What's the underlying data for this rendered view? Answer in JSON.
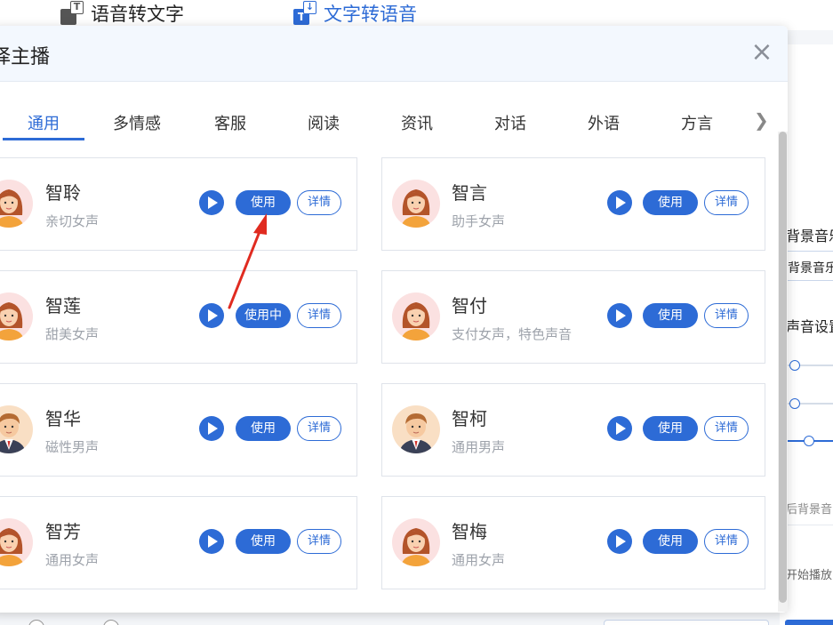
{
  "colors": {
    "accent": "#2d6bd6",
    "annotation_arrow": "#e02b20"
  },
  "top_tabs": [
    {
      "label": "语音转文字",
      "icon": "speech-to-text-icon",
      "active": false
    },
    {
      "label": "文字转语音",
      "icon": "text-to-speech-icon",
      "active": true
    }
  ],
  "modal": {
    "title": "择主播",
    "tabs": [
      "通用",
      "多情感",
      "客服",
      "阅读",
      "资讯",
      "对话",
      "外语",
      "方言"
    ],
    "active_tab": "通用"
  },
  "voices": [
    {
      "name": "智聆",
      "desc": "亲切女声",
      "gender": "female",
      "use_label": "使用",
      "detail_label": "详情"
    },
    {
      "name": "智言",
      "desc": "助手女声",
      "gender": "female",
      "use_label": "使用",
      "detail_label": "详情"
    },
    {
      "name": "智莲",
      "desc": "甜美女声",
      "gender": "female",
      "use_label": "使用中",
      "detail_label": "详情"
    },
    {
      "name": "智付",
      "desc": "支付女声，特色声音",
      "gender": "female",
      "use_label": "使用",
      "detail_label": "详情"
    },
    {
      "name": "智华",
      "desc": "磁性男声",
      "gender": "male",
      "use_label": "使用",
      "detail_label": "详情"
    },
    {
      "name": "智柯",
      "desc": "通用男声",
      "gender": "male",
      "use_label": "使用",
      "detail_label": "详情"
    },
    {
      "name": "智芳",
      "desc": "通用女声",
      "gender": "female",
      "use_label": "使用",
      "detail_label": "详情"
    },
    {
      "name": "智梅",
      "desc": "通用女声",
      "gender": "female",
      "use_label": "使用",
      "detail_label": "详情"
    }
  ],
  "background_panel": {
    "label_music": "背景音乐",
    "select_music": "背景音乐",
    "label_voice_settings": "声音设置",
    "label_bottom_note": "后背景音",
    "label_start": "开始播放"
  }
}
